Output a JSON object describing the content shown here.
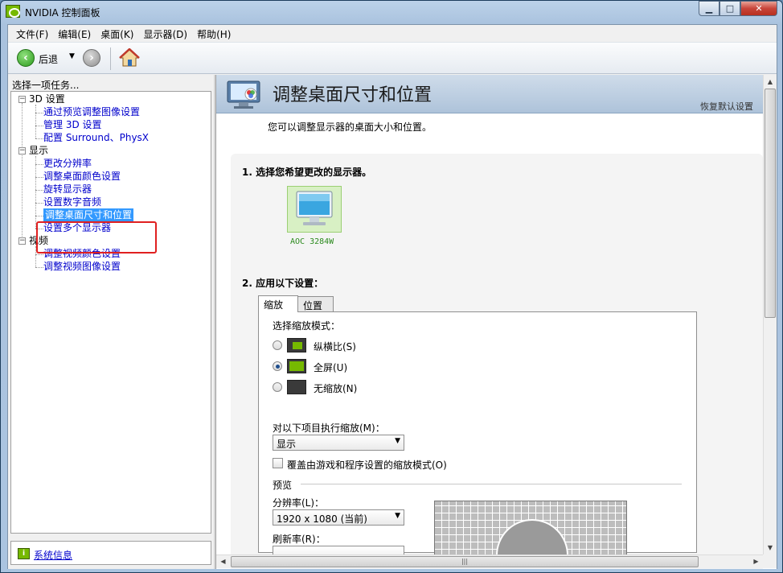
{
  "window": {
    "title": "NVIDIA 控制面板",
    "controls": {
      "minimize": "▁",
      "maximize": "□",
      "close": "✕"
    }
  },
  "menubar": {
    "items": [
      "文件(F)",
      "编辑(E)",
      "桌面(K)",
      "显示器(D)",
      "帮助(H)"
    ]
  },
  "toolbar": {
    "back_label": "后退",
    "back_icon": "arrow-left-icon",
    "forward_icon": "arrow-right-icon",
    "home_icon": "home-icon"
  },
  "sidebar": {
    "heading": "选择一项任务...",
    "groups": [
      {
        "label": "3D 设置",
        "items": [
          "通过预览调整图像设置",
          "管理 3D 设置",
          "配置 Surround、PhysX"
        ]
      },
      {
        "label": "显示",
        "items": [
          "更改分辨率",
          "调整桌面颜色设置",
          "旋转显示器",
          "设置数字音频",
          "调整桌面尺寸和位置",
          "设置多个显示器"
        ]
      },
      {
        "label": "视频",
        "items": [
          "调整视频颜色设置",
          "调整视频图像设置"
        ]
      }
    ],
    "selected": "调整桌面尺寸和位置",
    "system_info": "系统信息"
  },
  "content": {
    "title": "调整桌面尺寸和位置",
    "restore_defaults": "恢复默认设置",
    "description": "您可以调整显示器的桌面大小和位置。",
    "step1": "1. 选择您希望更改的显示器。",
    "monitor_label": "AOC 3284W",
    "step2": "2. 应用以下设置：",
    "tabs": [
      "缩放",
      "位置"
    ],
    "scaling": {
      "mode_label": "选择缩放模式：",
      "options": [
        "纵横比(S)",
        "全屏(U)",
        "无缩放(N)"
      ],
      "selected_option": "全屏(U)",
      "perform_on_label": "对以下项目执行缩放(M)：",
      "perform_on_value": "显示",
      "override_label": "覆盖由游戏和程序设置的缩放模式(O)",
      "override_checked": false,
      "preview_label": "预览",
      "resolution_label": "分辨率(L)：",
      "resolution_value": "1920 x 1080 (当前)",
      "refresh_label": "刷新率(R)："
    }
  },
  "colors": {
    "nvidia_green": "#76b900",
    "selection": "#3399ff",
    "link": "#0000cc",
    "highlight_box": "#e02020"
  }
}
